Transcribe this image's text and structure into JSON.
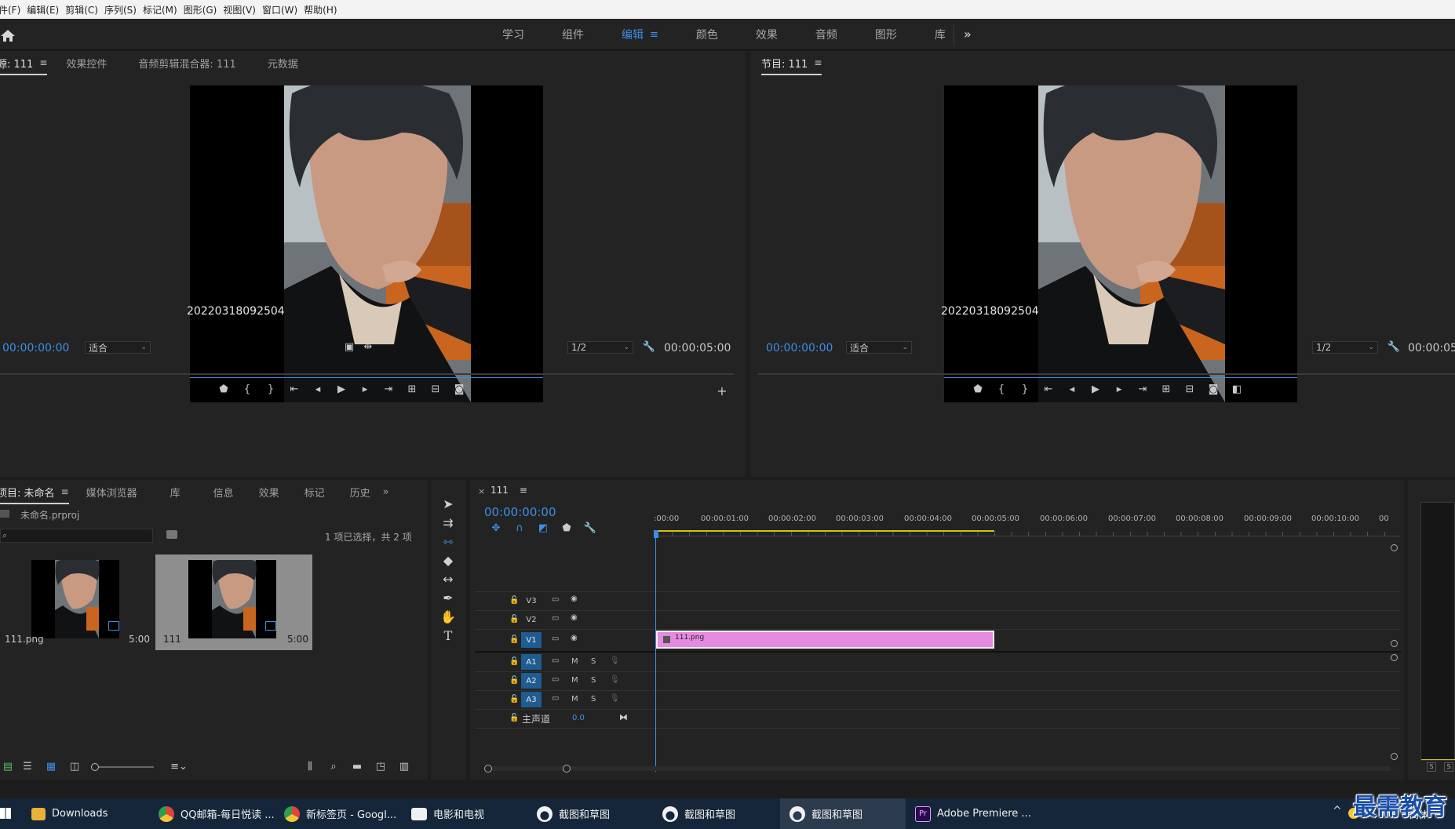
{
  "menu": [
    "件(F)",
    "编辑(E)",
    "剪辑(C)",
    "序列(S)",
    "标记(M)",
    "图形(G)",
    "视图(V)",
    "窗口(W)",
    "帮助(H)"
  ],
  "workspaces": [
    {
      "label": "学习",
      "active": false
    },
    {
      "label": "组件",
      "active": false
    },
    {
      "label": "编辑",
      "active": true
    },
    {
      "label": "颜色",
      "active": false
    },
    {
      "label": "效果",
      "active": false
    },
    {
      "label": "音频",
      "active": false
    },
    {
      "label": "图形",
      "active": false
    },
    {
      "label": "库",
      "active": false
    }
  ],
  "source_panel": {
    "tabs": [
      "源: 111",
      "效果控件",
      "音频剪辑混合器: 111",
      "元数据"
    ],
    "overlay_text": "20220318092504",
    "timecode": "00:00:00:00",
    "fit": "适合",
    "resolution": "1/2",
    "duration": "00:00:05:00"
  },
  "program_panel": {
    "tab": "节目: 111",
    "overlay_text": "20220318092504",
    "timecode": "00:00:00:00",
    "fit": "适合",
    "resolution": "1/2",
    "duration": "00:00:05:"
  },
  "project_panel": {
    "tabs": [
      "项目: 未命名",
      "媒体浏览器",
      "库",
      "信息",
      "效果",
      "标记",
      "历史"
    ],
    "project_file": "未命名.prproj",
    "selection_info": "1 项已选择，共 2 项",
    "items": [
      {
        "name": "111.png",
        "duration": "5:00",
        "selected": false
      },
      {
        "name": "111",
        "duration": "5:00",
        "selected": true
      }
    ]
  },
  "timeline": {
    "sequence": "111",
    "timecode": "00:00:00:00",
    "ruler_labels": [
      ":00:00",
      "00:00:01:00",
      "00:00:02:00",
      "00:00:03:00",
      "00:00:04:00",
      "00:00:05:00",
      "00:00:06:00",
      "00:00:07:00",
      "00:00:08:00",
      "00:00:09:00",
      "00:00:10:00",
      "00"
    ],
    "video_tracks": [
      "V3",
      "V2",
      "V1"
    ],
    "audio_tracks": [
      "A1",
      "A2",
      "A3"
    ],
    "master_label": "主声道",
    "master_value": "0.0",
    "clip_name": "111.png"
  },
  "taskbar": {
    "items": [
      {
        "label": "Downloads",
        "color": "#e8b13a"
      },
      {
        "label": "QQ邮箱-每日悦读 ...",
        "color": "#e0453a"
      },
      {
        "label": "新标签页 - Googl...",
        "color": "#e0453a"
      },
      {
        "label": "电影和电视",
        "color": "#ffffff"
      },
      {
        "label": "截图和草图",
        "color": "#ffffff"
      },
      {
        "label": "截图和草图",
        "color": "#ffffff"
      },
      {
        "label": "截图和草图",
        "color": "#ffffff"
      },
      {
        "label": "Adobe Premiere ...",
        "color": "#2a0a4a"
      }
    ],
    "tray_text": "简体"
  },
  "watermark": "最需教育"
}
